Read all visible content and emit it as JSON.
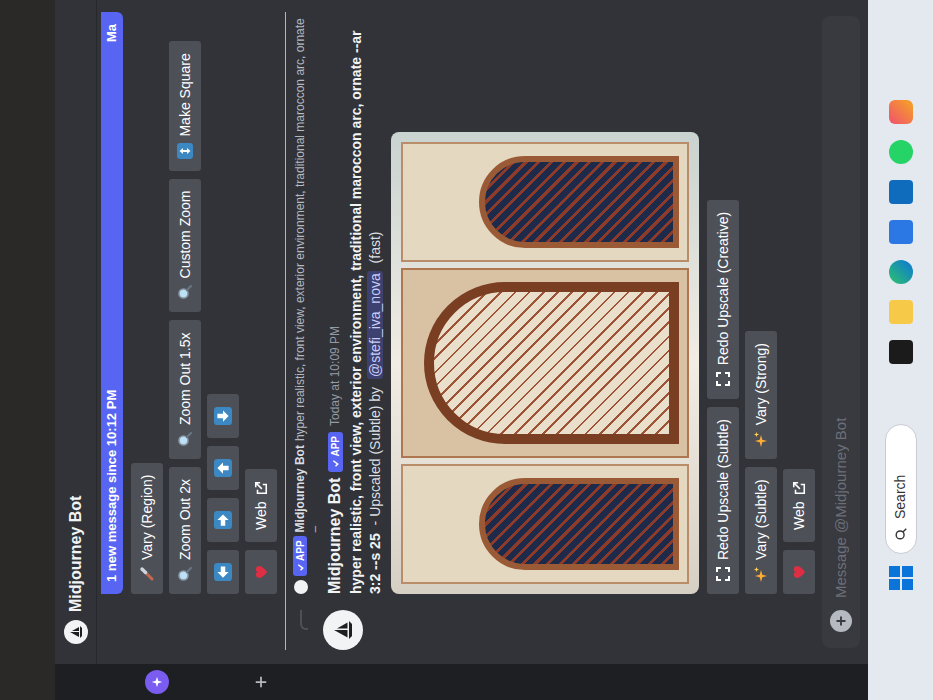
{
  "channel": {
    "title": "Midjourney Bot"
  },
  "new_messages": {
    "text": "1 new message since 10:12 PM",
    "action": "Ma"
  },
  "previous_message": {
    "button_rows": [
      [
        {
          "kind": "brush",
          "label": "Vary (Region)"
        }
      ],
      [
        {
          "kind": "zoom",
          "label": "Zoom Out 2x"
        },
        {
          "kind": "zoom",
          "label": "Zoom Out 1.5x"
        },
        {
          "kind": "zoom",
          "label": "Custom Zoom"
        },
        {
          "kind": "square",
          "label": "Make Square"
        }
      ],
      [
        {
          "kind": "left"
        },
        {
          "kind": "right"
        },
        {
          "kind": "up"
        },
        {
          "kind": "down"
        }
      ],
      [
        {
          "kind": "heart"
        },
        {
          "kind": "web",
          "label": "Web"
        }
      ]
    ]
  },
  "message": {
    "reply": {
      "badge": "APP",
      "author": "Midjourney Bot",
      "text": "hyper realistic, front view, exterior environment, traditional maroccon arc, ornate –"
    },
    "author": "Midjourney Bot",
    "badge": "APP",
    "time": "Today at 10:09 PM",
    "prompt": "hyper realistic, front view, exterior environment, traditional maroccon arc, ornate --ar 3:2 --s 25",
    "status": "- Upscaled (Subtle) by",
    "mention": "@stefi_iva_nova",
    "speed": "(fast)",
    "button_rows": [
      [
        {
          "kind": "redo",
          "label": "Redo Upscale (Subtle)"
        },
        {
          "kind": "redo",
          "label": "Redo Upscale (Creative)"
        }
      ],
      [
        {
          "kind": "sparkle",
          "label": "Vary (Subtle)"
        },
        {
          "kind": "sparkle",
          "label": "Vary (Strong)"
        }
      ],
      [
        {
          "kind": "heart"
        },
        {
          "kind": "web",
          "label": "Web"
        }
      ]
    ]
  },
  "composer": {
    "placeholder": "Message @Midjourney Bot"
  },
  "taskbar": {
    "search": "Search"
  }
}
